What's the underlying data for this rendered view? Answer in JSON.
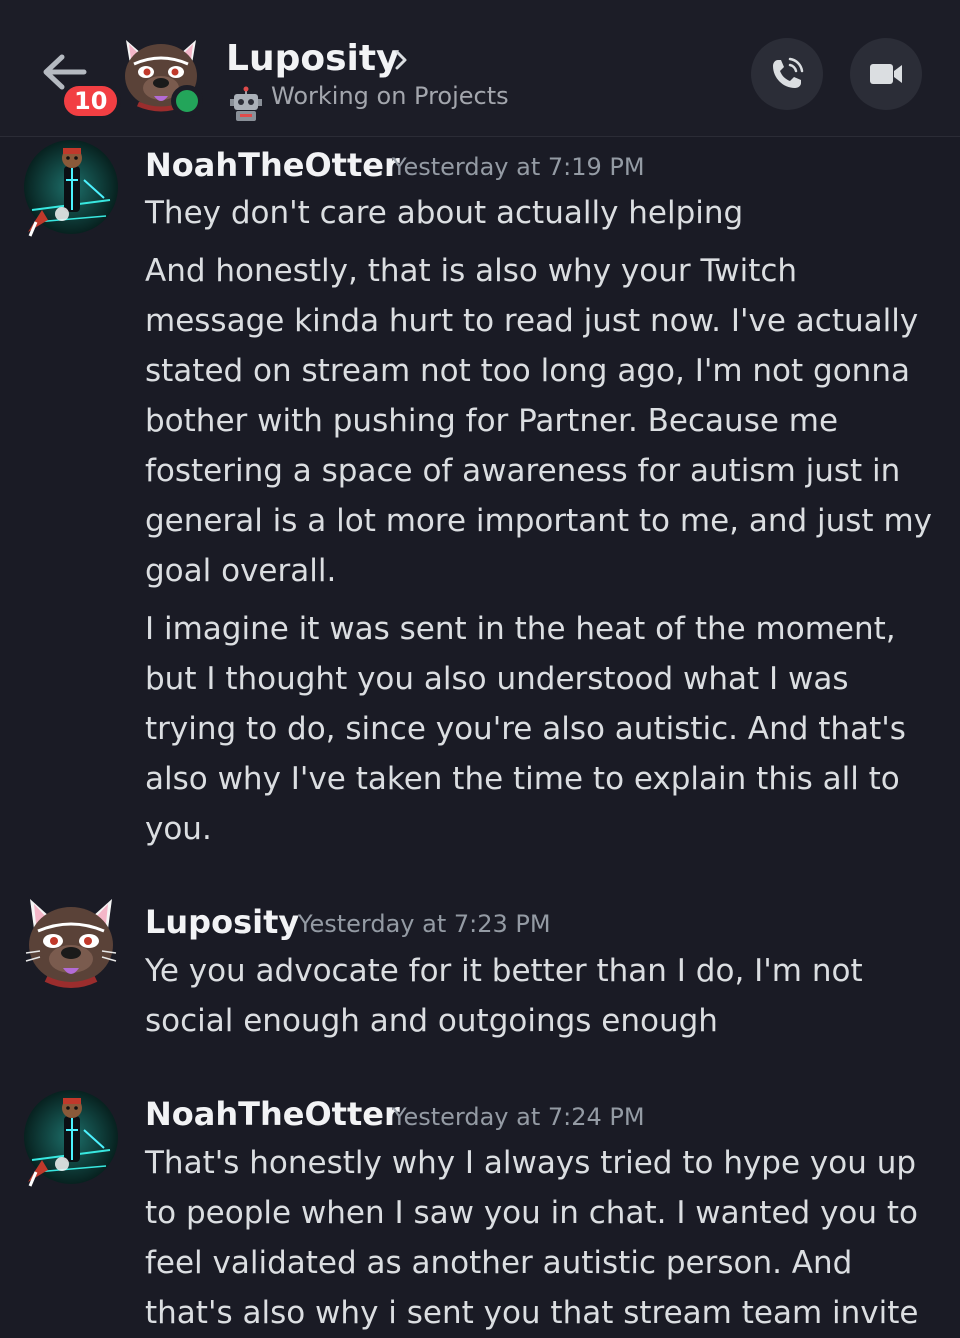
{
  "header": {
    "unread_count": "10",
    "title": "Luposity",
    "status": "Working on Projects"
  },
  "messages": [
    {
      "author": "NoahTheOtter",
      "timestamp": "Yesterday at 7:19 PM",
      "paragraphs": [
        "They don't care about actually helping",
        "And honestly, that is also why your Twitch message kinda hurt to read just now. I've actually stated on stream not too long ago, I'm not gonna bother with pushing for Partner. Because me fostering a space of awareness for autism just in general is a lot more important to me, and just my goal overall.",
        "I imagine it was sent in the heat of the moment, but I thought you also understood what I was trying to do, since you're also autistic. And that's also why I've taken the time to explain this all to you."
      ]
    },
    {
      "author": "Luposity",
      "timestamp": "Yesterday at 7:23 PM",
      "paragraphs": [
        "Ye you advocate for it better than I do, I'm not social enough and outgoings enough"
      ]
    },
    {
      "author": "NoahTheOtter",
      "timestamp": "Yesterday at 7:24 PM",
      "paragraphs": [
        "That's honestly why I always tried to hype you up to people when I saw you in chat. I wanted you to feel validated as another autistic person. And that's also why i sent you that stream team invite"
      ]
    }
  ],
  "colors": {
    "background": "#1a1b25",
    "badge": "#f23f43",
    "online": "#23a55a",
    "muted_text": "#949ba4"
  },
  "icons": [
    "back-arrow-icon",
    "chevron-right-icon",
    "robot-icon",
    "phone-call-icon",
    "video-camera-icon"
  ]
}
